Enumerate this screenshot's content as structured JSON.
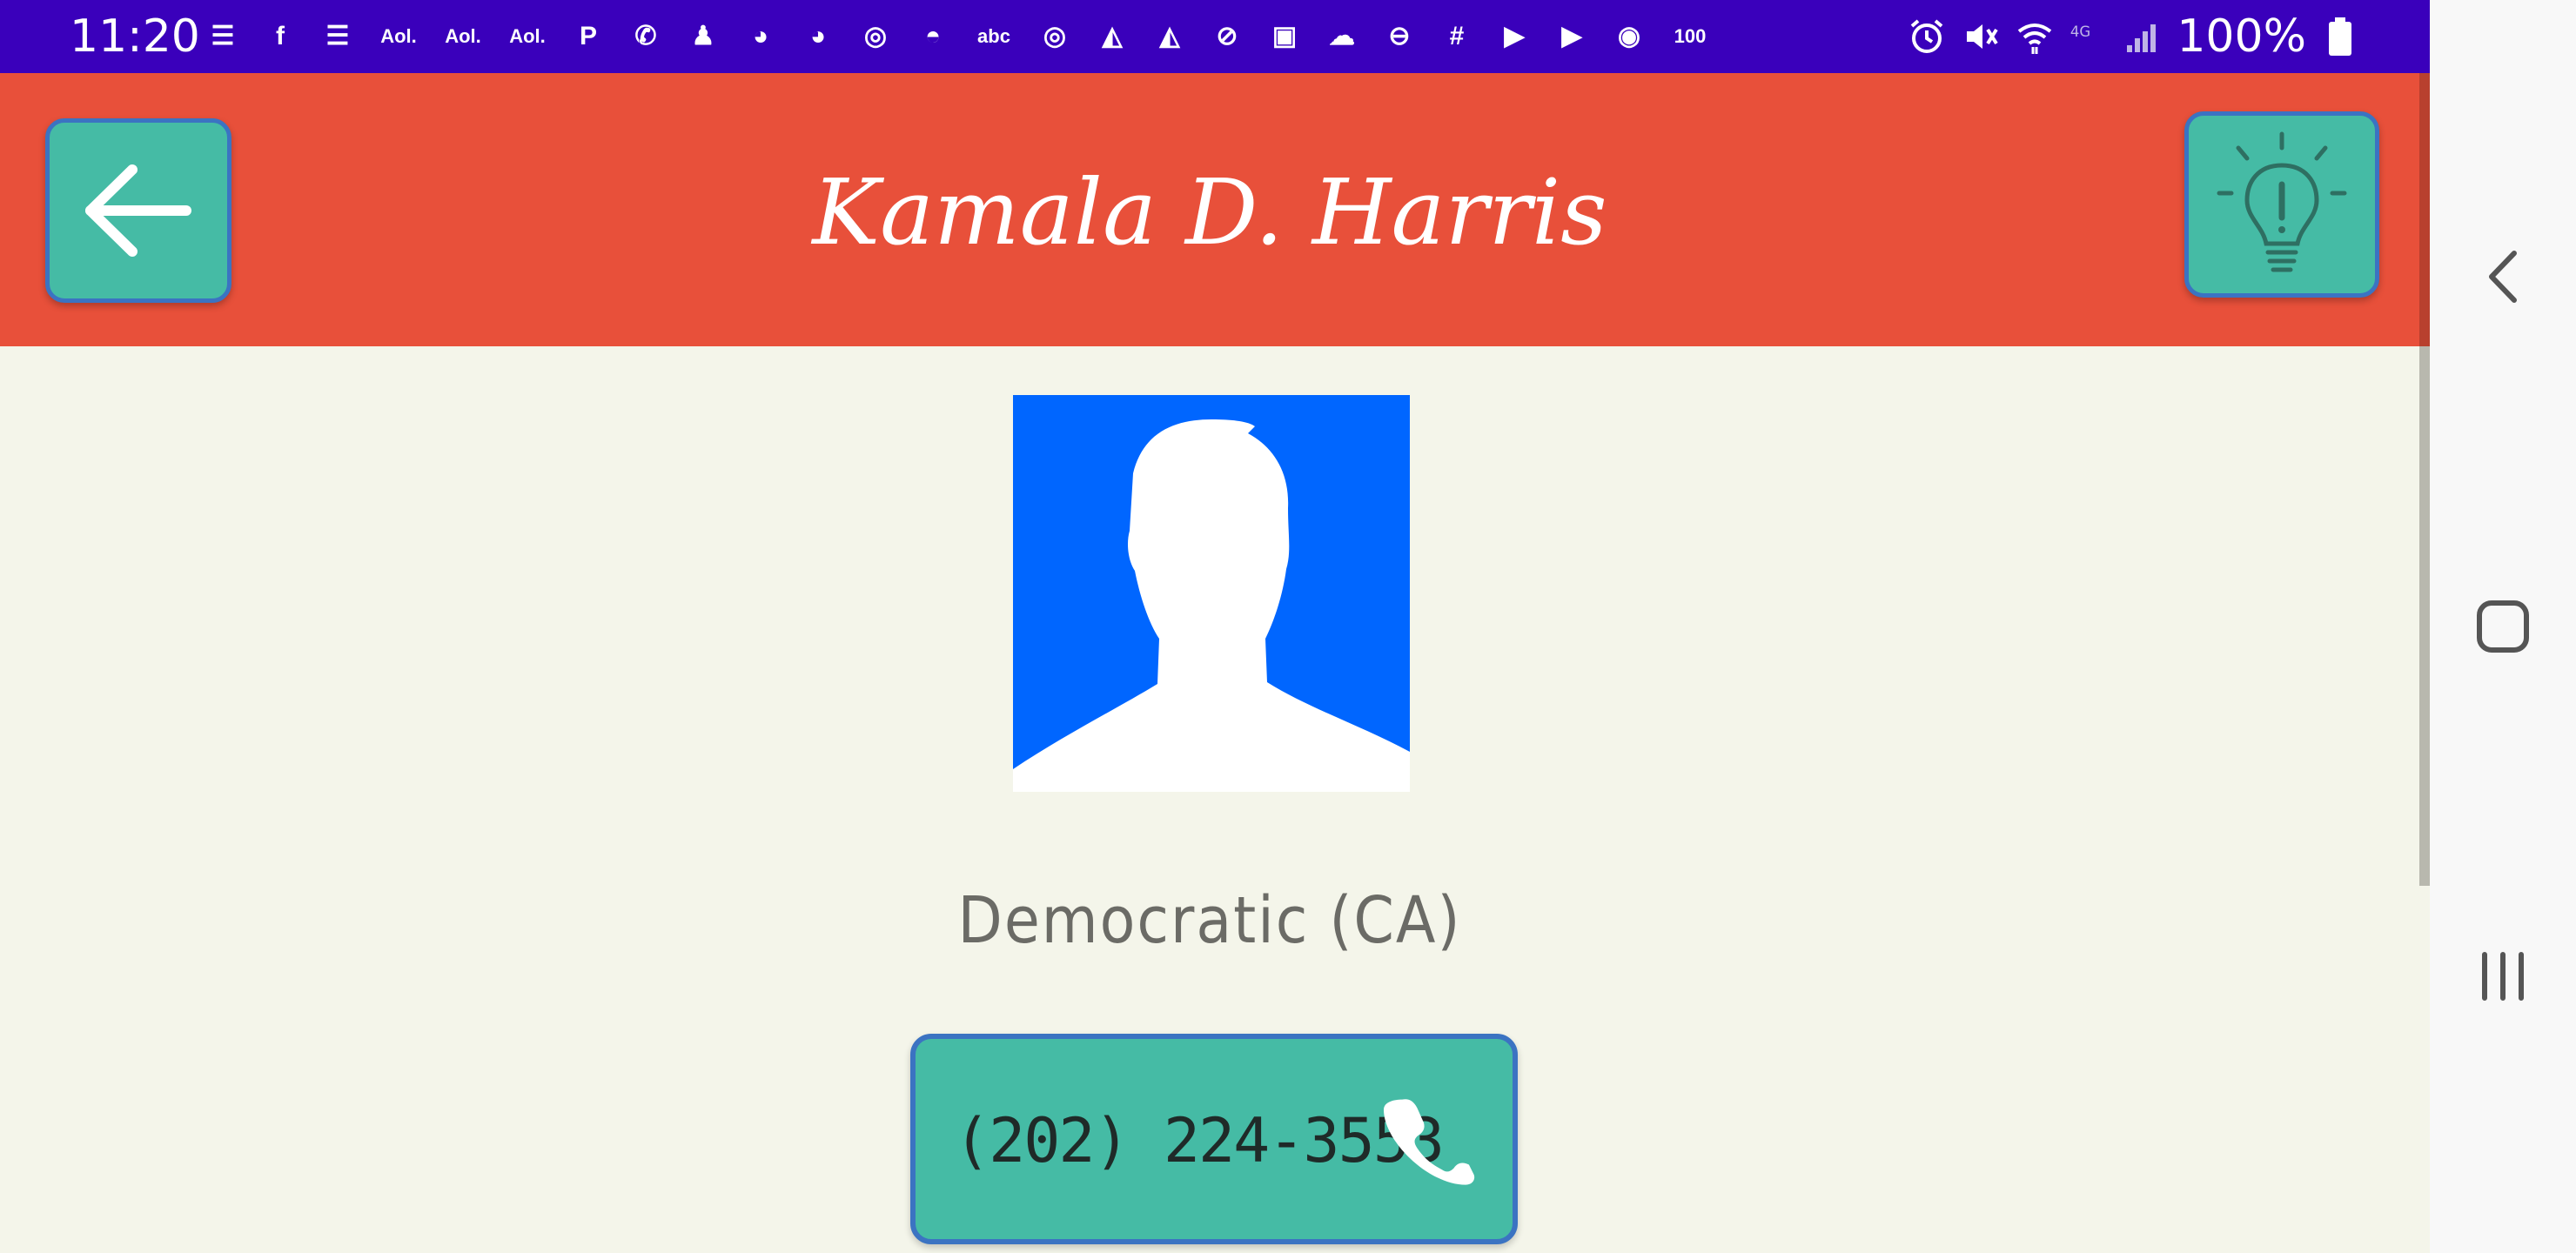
{
  "status_bar": {
    "time": "11:20",
    "battery": "100%",
    "notification_icons": [
      {
        "name": "news-icon",
        "glyph": "☰"
      },
      {
        "name": "facebook-icon",
        "glyph": "f"
      },
      {
        "name": "news-icon-2",
        "glyph": "☰"
      },
      {
        "name": "aol-icon-1",
        "glyph": "Aol."
      },
      {
        "name": "aol-icon-2",
        "glyph": "Aol."
      },
      {
        "name": "aol-icon-3",
        "glyph": "Aol."
      },
      {
        "name": "pinterest-icon",
        "glyph": "P"
      },
      {
        "name": "wifi-call-icon",
        "glyph": "✆"
      },
      {
        "name": "app-icon",
        "glyph": "♟"
      },
      {
        "name": "reddit-icon-1",
        "glyph": "◕"
      },
      {
        "name": "reddit-icon-2",
        "glyph": "◕"
      },
      {
        "name": "instagram-icon-1",
        "glyph": "◎"
      },
      {
        "name": "weather-icon",
        "glyph": "◓"
      },
      {
        "name": "abc-icon",
        "glyph": "abc"
      },
      {
        "name": "instagram-icon-2",
        "glyph": "◎"
      },
      {
        "name": "pizza-icon-1",
        "glyph": "◭"
      },
      {
        "name": "pizza-icon-2",
        "glyph": "◭"
      },
      {
        "name": "no-sync-icon",
        "glyph": "⊘"
      },
      {
        "name": "image-icon",
        "glyph": "▣"
      },
      {
        "name": "cloud-icon",
        "glyph": "☁"
      },
      {
        "name": "do-not-disturb-icon",
        "glyph": "⊖"
      },
      {
        "name": "slack-icon",
        "glyph": "#"
      },
      {
        "name": "youtube-icon-1",
        "glyph": "▶"
      },
      {
        "name": "youtube-icon-2",
        "glyph": "▶"
      },
      {
        "name": "ghost-icon",
        "glyph": "◉"
      },
      {
        "name": "battery-100-icon",
        "glyph": "100"
      }
    ]
  },
  "header": {
    "title": "Kamala D. Harris"
  },
  "profile": {
    "party": "Democratic (CA)",
    "phone": "(202) 224-3553"
  },
  "colors": {
    "status_bar": "#3a00bb",
    "header": "#e8503a",
    "button": "#45bba5",
    "button_border": "#3b73c2",
    "background": "#f4f5ea",
    "avatar_bg": "#0066ff"
  }
}
